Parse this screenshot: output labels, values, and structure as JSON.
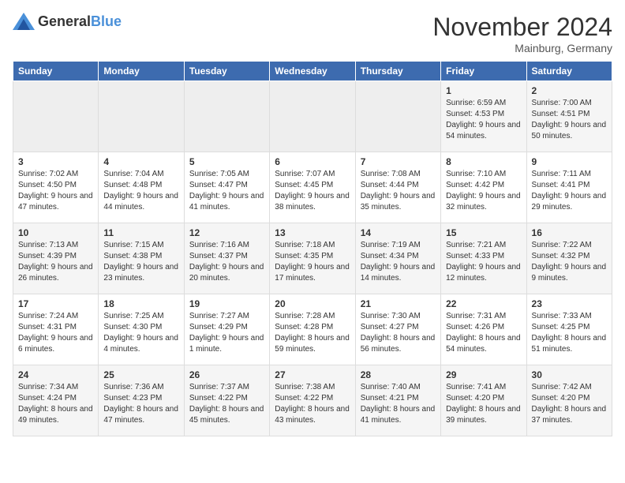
{
  "header": {
    "logo_general": "General",
    "logo_blue": "Blue",
    "month_title": "November 2024",
    "location": "Mainburg, Germany"
  },
  "days_of_week": [
    "Sunday",
    "Monday",
    "Tuesday",
    "Wednesday",
    "Thursday",
    "Friday",
    "Saturday"
  ],
  "weeks": [
    [
      {
        "day": "",
        "empty": true
      },
      {
        "day": "",
        "empty": true
      },
      {
        "day": "",
        "empty": true
      },
      {
        "day": "",
        "empty": true
      },
      {
        "day": "",
        "empty": true
      },
      {
        "day": "1",
        "sunrise": "Sunrise: 6:59 AM",
        "sunset": "Sunset: 4:53 PM",
        "daylight": "Daylight: 9 hours and 54 minutes."
      },
      {
        "day": "2",
        "sunrise": "Sunrise: 7:00 AM",
        "sunset": "Sunset: 4:51 PM",
        "daylight": "Daylight: 9 hours and 50 minutes."
      }
    ],
    [
      {
        "day": "3",
        "sunrise": "Sunrise: 7:02 AM",
        "sunset": "Sunset: 4:50 PM",
        "daylight": "Daylight: 9 hours and 47 minutes."
      },
      {
        "day": "4",
        "sunrise": "Sunrise: 7:04 AM",
        "sunset": "Sunset: 4:48 PM",
        "daylight": "Daylight: 9 hours and 44 minutes."
      },
      {
        "day": "5",
        "sunrise": "Sunrise: 7:05 AM",
        "sunset": "Sunset: 4:47 PM",
        "daylight": "Daylight: 9 hours and 41 minutes."
      },
      {
        "day": "6",
        "sunrise": "Sunrise: 7:07 AM",
        "sunset": "Sunset: 4:45 PM",
        "daylight": "Daylight: 9 hours and 38 minutes."
      },
      {
        "day": "7",
        "sunrise": "Sunrise: 7:08 AM",
        "sunset": "Sunset: 4:44 PM",
        "daylight": "Daylight: 9 hours and 35 minutes."
      },
      {
        "day": "8",
        "sunrise": "Sunrise: 7:10 AM",
        "sunset": "Sunset: 4:42 PM",
        "daylight": "Daylight: 9 hours and 32 minutes."
      },
      {
        "day": "9",
        "sunrise": "Sunrise: 7:11 AM",
        "sunset": "Sunset: 4:41 PM",
        "daylight": "Daylight: 9 hours and 29 minutes."
      }
    ],
    [
      {
        "day": "10",
        "sunrise": "Sunrise: 7:13 AM",
        "sunset": "Sunset: 4:39 PM",
        "daylight": "Daylight: 9 hours and 26 minutes."
      },
      {
        "day": "11",
        "sunrise": "Sunrise: 7:15 AM",
        "sunset": "Sunset: 4:38 PM",
        "daylight": "Daylight: 9 hours and 23 minutes."
      },
      {
        "day": "12",
        "sunrise": "Sunrise: 7:16 AM",
        "sunset": "Sunset: 4:37 PM",
        "daylight": "Daylight: 9 hours and 20 minutes."
      },
      {
        "day": "13",
        "sunrise": "Sunrise: 7:18 AM",
        "sunset": "Sunset: 4:35 PM",
        "daylight": "Daylight: 9 hours and 17 minutes."
      },
      {
        "day": "14",
        "sunrise": "Sunrise: 7:19 AM",
        "sunset": "Sunset: 4:34 PM",
        "daylight": "Daylight: 9 hours and 14 minutes."
      },
      {
        "day": "15",
        "sunrise": "Sunrise: 7:21 AM",
        "sunset": "Sunset: 4:33 PM",
        "daylight": "Daylight: 9 hours and 12 minutes."
      },
      {
        "day": "16",
        "sunrise": "Sunrise: 7:22 AM",
        "sunset": "Sunset: 4:32 PM",
        "daylight": "Daylight: 9 hours and 9 minutes."
      }
    ],
    [
      {
        "day": "17",
        "sunrise": "Sunrise: 7:24 AM",
        "sunset": "Sunset: 4:31 PM",
        "daylight": "Daylight: 9 hours and 6 minutes."
      },
      {
        "day": "18",
        "sunrise": "Sunrise: 7:25 AM",
        "sunset": "Sunset: 4:30 PM",
        "daylight": "Daylight: 9 hours and 4 minutes."
      },
      {
        "day": "19",
        "sunrise": "Sunrise: 7:27 AM",
        "sunset": "Sunset: 4:29 PM",
        "daylight": "Daylight: 9 hours and 1 minute."
      },
      {
        "day": "20",
        "sunrise": "Sunrise: 7:28 AM",
        "sunset": "Sunset: 4:28 PM",
        "daylight": "Daylight: 8 hours and 59 minutes."
      },
      {
        "day": "21",
        "sunrise": "Sunrise: 7:30 AM",
        "sunset": "Sunset: 4:27 PM",
        "daylight": "Daylight: 8 hours and 56 minutes."
      },
      {
        "day": "22",
        "sunrise": "Sunrise: 7:31 AM",
        "sunset": "Sunset: 4:26 PM",
        "daylight": "Daylight: 8 hours and 54 minutes."
      },
      {
        "day": "23",
        "sunrise": "Sunrise: 7:33 AM",
        "sunset": "Sunset: 4:25 PM",
        "daylight": "Daylight: 8 hours and 51 minutes."
      }
    ],
    [
      {
        "day": "24",
        "sunrise": "Sunrise: 7:34 AM",
        "sunset": "Sunset: 4:24 PM",
        "daylight": "Daylight: 8 hours and 49 minutes."
      },
      {
        "day": "25",
        "sunrise": "Sunrise: 7:36 AM",
        "sunset": "Sunset: 4:23 PM",
        "daylight": "Daylight: 8 hours and 47 minutes."
      },
      {
        "day": "26",
        "sunrise": "Sunrise: 7:37 AM",
        "sunset": "Sunset: 4:22 PM",
        "daylight": "Daylight: 8 hours and 45 minutes."
      },
      {
        "day": "27",
        "sunrise": "Sunrise: 7:38 AM",
        "sunset": "Sunset: 4:22 PM",
        "daylight": "Daylight: 8 hours and 43 minutes."
      },
      {
        "day": "28",
        "sunrise": "Sunrise: 7:40 AM",
        "sunset": "Sunset: 4:21 PM",
        "daylight": "Daylight: 8 hours and 41 minutes."
      },
      {
        "day": "29",
        "sunrise": "Sunrise: 7:41 AM",
        "sunset": "Sunset: 4:20 PM",
        "daylight": "Daylight: 8 hours and 39 minutes."
      },
      {
        "day": "30",
        "sunrise": "Sunrise: 7:42 AM",
        "sunset": "Sunset: 4:20 PM",
        "daylight": "Daylight: 8 hours and 37 minutes."
      }
    ]
  ]
}
